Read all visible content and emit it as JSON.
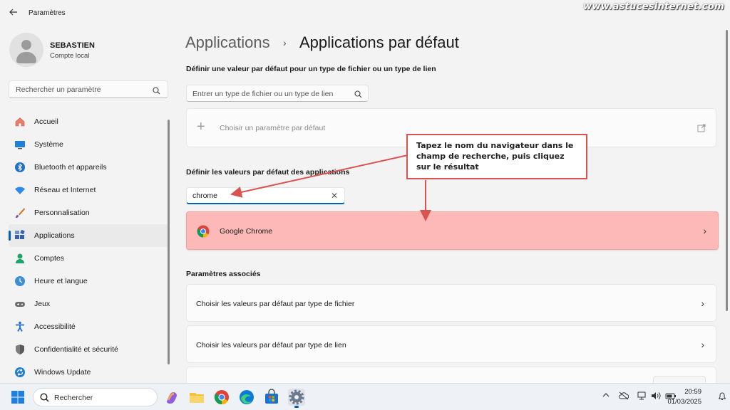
{
  "window": {
    "title": "Paramètres",
    "watermark": "www.astucesinternet.com"
  },
  "profile": {
    "name": "SEBASTIEN",
    "account_type": "Compte local"
  },
  "search": {
    "placeholder": "Rechercher un paramètre"
  },
  "sidebar": {
    "items": [
      {
        "label": "Accueil",
        "icon": "home-icon",
        "active": false
      },
      {
        "label": "Système",
        "icon": "system-icon",
        "active": false
      },
      {
        "label": "Bluetooth et appareils",
        "icon": "bluetooth-icon",
        "active": false
      },
      {
        "label": "Réseau et Internet",
        "icon": "wifi-icon",
        "active": false
      },
      {
        "label": "Personnalisation",
        "icon": "brush-icon",
        "active": false
      },
      {
        "label": "Applications",
        "icon": "apps-icon",
        "active": true
      },
      {
        "label": "Comptes",
        "icon": "person-icon",
        "active": false
      },
      {
        "label": "Heure et langue",
        "icon": "clock-globe-icon",
        "active": false
      },
      {
        "label": "Jeux",
        "icon": "gamepad-icon",
        "active": false
      },
      {
        "label": "Accessibilité",
        "icon": "accessibility-icon",
        "active": false
      },
      {
        "label": "Confidentialité et sécurité",
        "icon": "shield-icon",
        "active": false
      },
      {
        "label": "Windows Update",
        "icon": "update-icon",
        "active": false
      }
    ]
  },
  "breadcrumb": {
    "parent": "Applications",
    "separator": "›",
    "current": "Applications par défaut"
  },
  "file_type_section": {
    "title": "Définir une valeur par défaut pour un type de fichier ou un type de lien",
    "search_placeholder": "Entrer un type de fichier ou un type de lien",
    "choose_default_label": "Choisir un paramètre par défaut"
  },
  "apps_section": {
    "title": "Définir les valeurs par défaut des applications",
    "search_value": "chrome",
    "result_label": "Google Chrome"
  },
  "annotation": {
    "text": "Tapez le nom du navigateur dans le champ de recherche, puis cliquez sur le résultat",
    "color": "#d9534f"
  },
  "related": {
    "title": "Paramètres associés",
    "items": [
      "Choisir les valeurs par défaut par type de fichier",
      "Choisir les valeurs par défaut par type de lien"
    ]
  },
  "taskbar": {
    "search_placeholder": "Rechercher",
    "time": "20:59",
    "date": "01/03/2025"
  },
  "colors": {
    "accent": "#005fb8",
    "highlight": "#fdb8b8"
  }
}
